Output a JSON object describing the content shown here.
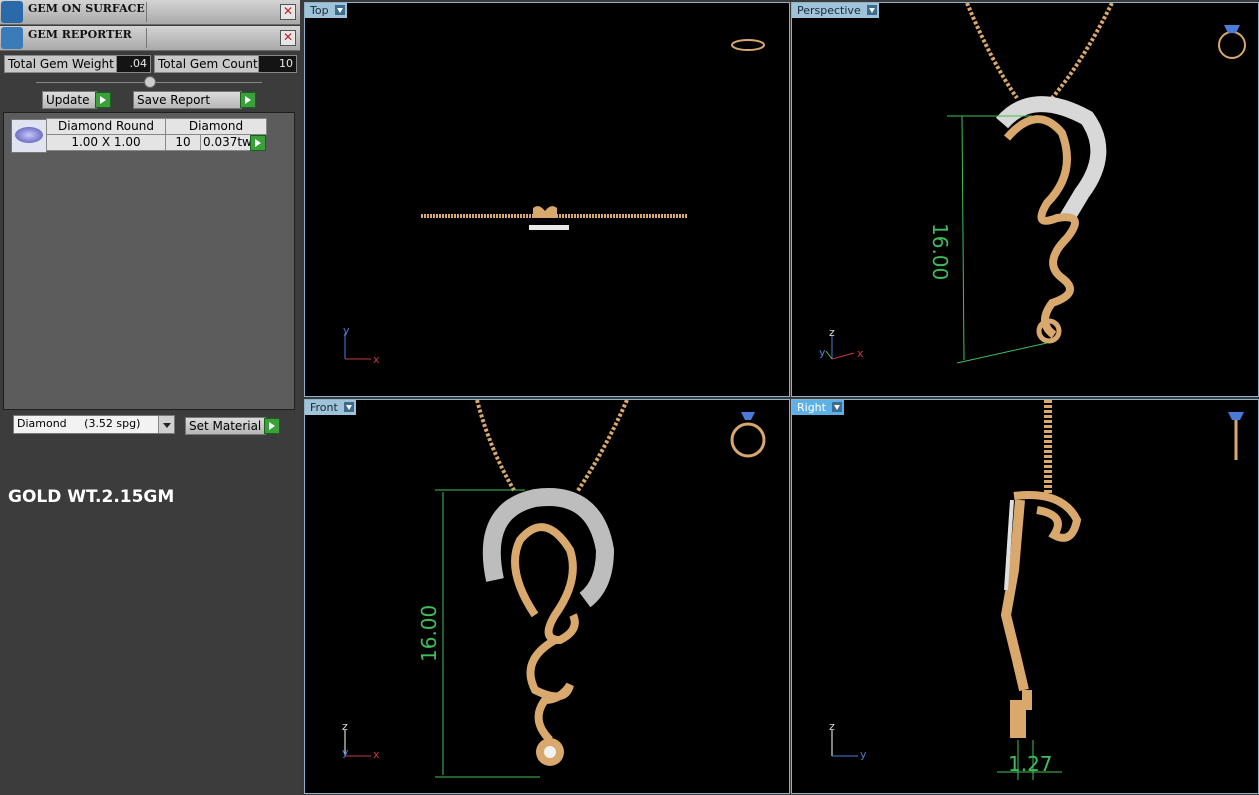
{
  "panel": {
    "gem_on_surface_title": "GEM ON SURFACE",
    "gem_reporter_title": "GEM REPORTER",
    "close_glyph": "✕",
    "total_weight_label": "Total Gem Weight",
    "total_weight_value": ".04",
    "total_count_label": "Total Gem Count",
    "total_count_value": "10",
    "update_label": "Update",
    "save_report_label": "Save Report"
  },
  "gem_table": {
    "columns": [
      "Diamond Round",
      "Diamond"
    ],
    "rows": [
      {
        "size": "1.00 X 1.00",
        "count": "10",
        "weight": "0.037tw"
      }
    ]
  },
  "material": {
    "selected": "Diamond     (3.52 spg)",
    "set_label": "Set Material"
  },
  "note": "GOLD WT.2.15GM",
  "viewports": {
    "top": {
      "label": "Top",
      "axes": [
        "y",
        "x"
      ]
    },
    "perspective": {
      "label": "Perspective",
      "axes": [
        "z",
        "y",
        "x"
      ],
      "dimension": "16.00"
    },
    "front": {
      "label": "Front",
      "axes": [
        "z",
        "y",
        "x"
      ],
      "dimension": "16.00"
    },
    "right": {
      "label": "Right",
      "axes": [
        "z",
        "y"
      ],
      "dimension": "1.27"
    }
  },
  "colors": {
    "gold": "#d9a86c",
    "dimension": "#3fbf5a",
    "active_tab": "#5fb0e6"
  }
}
